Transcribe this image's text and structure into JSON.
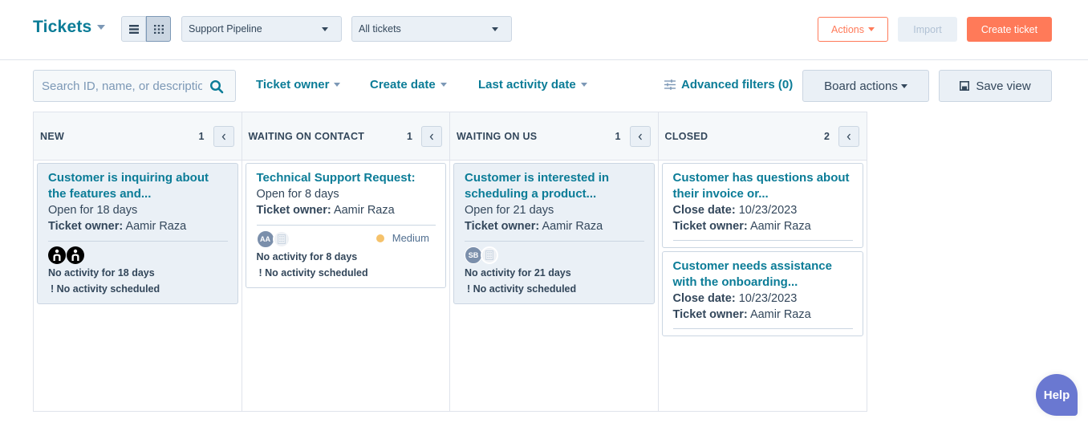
{
  "header": {
    "title": "Tickets",
    "view_modes": [
      {
        "name": "list-view",
        "icon": "list-icon",
        "active": false
      },
      {
        "name": "board-view",
        "icon": "grid-icon",
        "active": true
      }
    ],
    "pipeline_select": {
      "value": "Support Pipeline"
    },
    "view_select": {
      "value": "All tickets"
    },
    "actions_label": "Actions",
    "import_label": "Import",
    "create_label": "Create ticket",
    "colors": {
      "brand_teal": "#0b7c97",
      "accent_orange": "#ff7a59"
    }
  },
  "filters": {
    "search_placeholder": "Search ID, name, or description",
    "search_value": "",
    "items": [
      {
        "label": "Ticket owner"
      },
      {
        "label": "Create date"
      },
      {
        "label": "Last activity date"
      }
    ],
    "advanced_label": "Advanced filters (0)",
    "board_actions_label": "Board actions",
    "save_view_label": "Save view"
  },
  "board": {
    "columns": [
      {
        "name": "NEW",
        "count": "1",
        "cards": [
          {
            "title": "Customer is inquiring about the features and...",
            "line1": "Open for 18 days",
            "owner_label": "Ticket owner:",
            "owner": "Aamir Raza",
            "associations": [
              "contact-icon",
              "contact-icon"
            ],
            "activity": "No activity for 18 days",
            "scheduled": "! No activity scheduled"
          }
        ]
      },
      {
        "name": "WAITING ON CONTACT",
        "count": "1",
        "cards": [
          {
            "title": "Technical Support Request:",
            "line1": "Open for 8 days",
            "owner_label": "Ticket owner:",
            "owner": "Aamir Raza",
            "avatar_initials": "AA",
            "priority": "Medium",
            "priority_color": "#f5c26b",
            "activity": "No activity for 8 days",
            "scheduled": "! No activity scheduled"
          }
        ]
      },
      {
        "name": "WAITING ON US",
        "count": "1",
        "cards": [
          {
            "title": "Customer is interested in scheduling a product...",
            "line1": "Open for 21 days",
            "owner_label": "Ticket owner:",
            "owner": "Aamir Raza",
            "avatar_initials": "SB",
            "activity": "No activity for 21 days",
            "scheduled": "! No activity scheduled"
          }
        ]
      },
      {
        "name": "CLOSED",
        "count": "2",
        "cards": [
          {
            "title": "Customer has questions about their invoice or...",
            "date_label": "Close date:",
            "date": "10/23/2023",
            "owner_label": "Ticket owner:",
            "owner": "Aamir Raza"
          },
          {
            "title": "Customer needs assistance with the onboarding...",
            "date_label": "Close date:",
            "date": "10/23/2023",
            "owner_label": "Ticket owner:",
            "owner": "Aamir Raza"
          }
        ]
      }
    ]
  },
  "help_label": "Help"
}
